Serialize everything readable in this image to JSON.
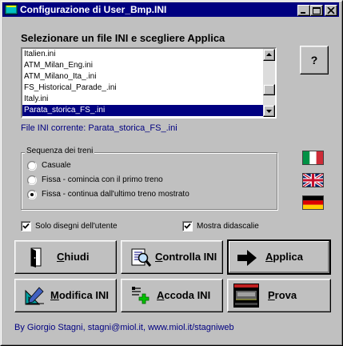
{
  "window": {
    "title": "Configurazione di User_Bmp.INI",
    "controls": [
      "minimize-icon",
      "maximize-icon",
      "close-icon"
    ]
  },
  "heading": "Selezionare un file INI e scegliere Applica",
  "file_list": {
    "items": [
      "Italien.ini",
      "ATM_Milan_Eng.ini",
      "ATM_Milano_Ita_.ini",
      "FS_Historical_Parade_.ini",
      "Italy.ini",
      "Parata_storica_FS_.ini"
    ],
    "selected": "Parata_storica_FS_.ini"
  },
  "help_button": {
    "label": "?"
  },
  "current_file": "File INI corrente: Parata_storica_FS_.ini",
  "train_sequence": {
    "title": "Sequenza dei treni",
    "options": [
      {
        "label": "Casuale",
        "checked": false
      },
      {
        "label": "Fissa - comincia con il primo treno",
        "checked": false
      },
      {
        "label": "Fissa - continua dall'ultimo treno mostrato",
        "checked": true
      }
    ]
  },
  "flags": [
    "italy-flag-icon",
    "uk-flag-icon",
    "germany-flag-icon"
  ],
  "checkboxes": {
    "user_drawings": {
      "label": "Solo disegni dell'utente",
      "checked": true
    },
    "show_captions": {
      "label": "Mostra didascalie",
      "checked": true
    }
  },
  "buttons": {
    "close": {
      "label": "Chiudi",
      "icon": "door-exit-icon"
    },
    "check_ini": {
      "label": "Controlla INI",
      "icon": "magnifier-icon"
    },
    "apply": {
      "label": "Applica",
      "icon": "arrow-right-icon"
    },
    "edit_ini": {
      "label": "Modifica INI",
      "icon": "ruler-pencil-icon"
    },
    "append_ini": {
      "label": "Accoda INI",
      "icon": "add-document-icon"
    },
    "test": {
      "label": "Prova",
      "icon": "train-preview-icon"
    }
  },
  "footer": "By Giorgio Stagni, stagni@miol.it, www.miol.it/stagniweb",
  "colors": {
    "titlebar": "#000080",
    "selection": "#000080",
    "face": "#c0c0c0",
    "link_text": "#000080"
  }
}
